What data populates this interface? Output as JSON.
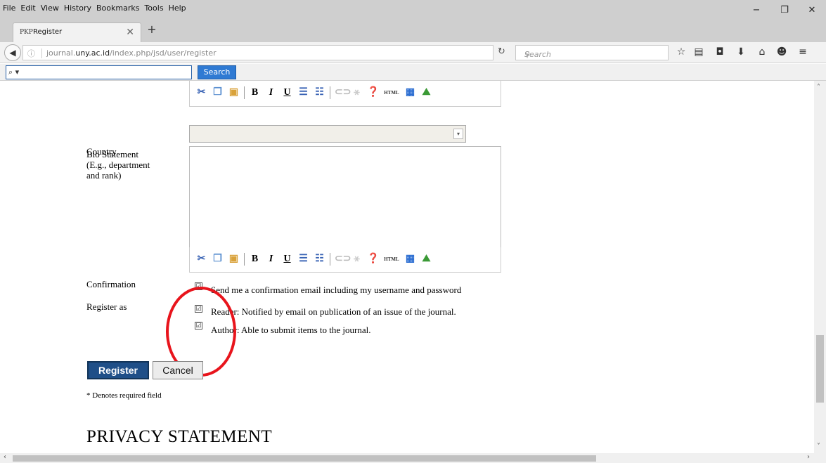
{
  "menu": [
    "File",
    "Edit",
    "View",
    "History",
    "Bookmarks",
    "Tools",
    "Help"
  ],
  "window_controls": {
    "minimize": "−",
    "restore": "❐",
    "close": "✕"
  },
  "tab": {
    "favicon": "PKP",
    "title": "Register",
    "close": "✕",
    "new": "+"
  },
  "nav": {
    "url_domain_prefix": "journal.",
    "url_domain": "uny.ac.id",
    "url_path": "/index.php/jsd/user/register",
    "search_placeholder": "Search"
  },
  "toolbar_search": {
    "input_value": "⌕ ▾",
    "button": "Search"
  },
  "editor_icons": [
    "cut-icon",
    "copy-icon",
    "paste-icon",
    "bold-icon",
    "italic-icon",
    "underline-icon",
    "bullet-list-icon",
    "numbered-list-icon",
    "link-icon",
    "unlink-icon",
    "help-icon",
    "html-icon",
    "fullscreen-icon",
    "image-icon"
  ],
  "editor_glyphs": {
    "bold": "B",
    "italic": "I",
    "underline": "U",
    "html": "HTML"
  },
  "form": {
    "country_label": "Country",
    "bio_label_1": "Bio Statement",
    "bio_label_2": "(E.g., department",
    "bio_label_3": "and rank)",
    "confirmation_label": "Confirmation",
    "confirmation_text": "Send me a confirmation email including my username and password",
    "register_as_label": "Register as",
    "reader_text": "Reader: Notified by email on publication of an issue of the journal.",
    "author_text": "Author: Able to submit items to the journal.",
    "register_button": "Register",
    "cancel_button": "Cancel",
    "required_note": "* Denotes required field",
    "privacy_heading": "PRIVACY STATEMENT"
  },
  "checkboxes": {
    "confirmation": "☑",
    "reader": "☑",
    "author": "☑"
  },
  "colors": {
    "annotation_circle": "#e8141c",
    "register_button": "#1f4f88",
    "search_button": "#2f7ad3"
  }
}
